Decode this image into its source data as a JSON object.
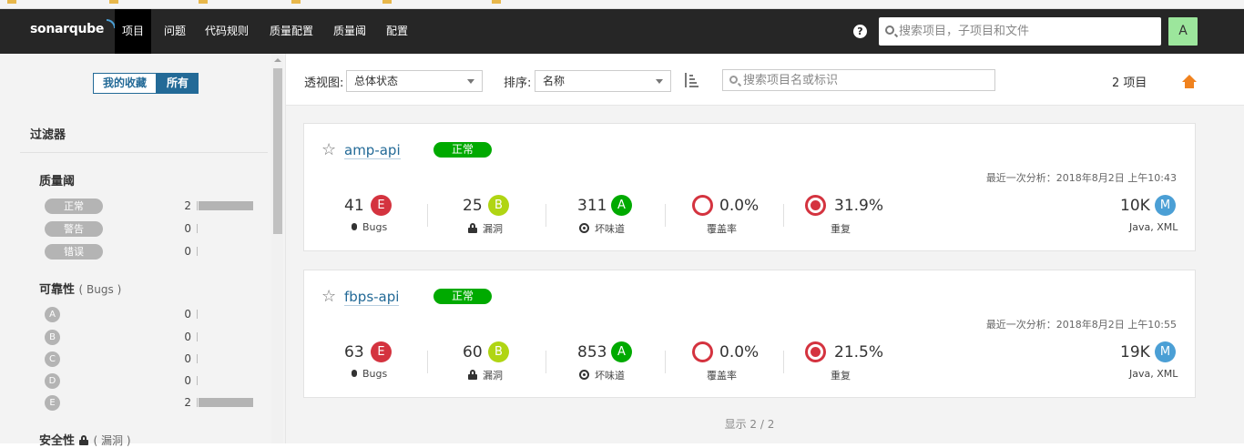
{
  "topnav": {
    "logo": "sonarqube",
    "items": [
      "项目",
      "问题",
      "代码规则",
      "质量配置",
      "质量阈",
      "配置"
    ],
    "help": "?",
    "search_placeholder": "搜索项目，子项目和文件",
    "avatar": "A"
  },
  "sidebar": {
    "toggle": {
      "favorites": "我的收藏",
      "all": "所有"
    },
    "filter_title": "过滤器",
    "quality_gate": {
      "title": "质量阈",
      "options": [
        {
          "label": "正常",
          "count": "2",
          "fraction": 1
        },
        {
          "label": "警告",
          "count": "0",
          "fraction": 0
        },
        {
          "label": "错误",
          "count": "0",
          "fraction": 0
        }
      ]
    },
    "reliability": {
      "title": "可靠性",
      "subtitle": "( Bugs )",
      "options": [
        {
          "label": "A",
          "count": "0",
          "fraction": 0
        },
        {
          "label": "B",
          "count": "0",
          "fraction": 0
        },
        {
          "label": "C",
          "count": "0",
          "fraction": 0
        },
        {
          "label": "D",
          "count": "0",
          "fraction": 0
        },
        {
          "label": "E",
          "count": "2",
          "fraction": 1
        }
      ]
    },
    "security": {
      "title": "安全性",
      "subtitle": "( 漏洞 )"
    }
  },
  "controls": {
    "perspective_label": "透视图:",
    "perspective_value": "总体状态",
    "sort_label": "排序:",
    "sort_value": "名称",
    "search_placeholder": "搜索项目名或标识",
    "project_count": "2 项目"
  },
  "projects": [
    {
      "name": "amp-api",
      "quality_gate": "正常",
      "last_analysis": "最近一次分析：2018年8月2日 上午10:43",
      "bugs": "41",
      "bugs_rating": "E",
      "bugs_label": "Bugs",
      "vulns": "25",
      "vulns_rating": "B",
      "vulns_label": "漏洞",
      "smells": "311",
      "smells_rating": "A",
      "smells_label": "坏味道",
      "coverage": "0.0%",
      "coverage_label": "覆盖率",
      "dup": "31.9%",
      "dup_label": "重复",
      "size": "10K",
      "size_rating": "M",
      "languages": "Java, XML"
    },
    {
      "name": "fbps-api",
      "quality_gate": "正常",
      "last_analysis": "最近一次分析：2018年8月2日 上午10:55",
      "bugs": "63",
      "bugs_rating": "E",
      "bugs_label": "Bugs",
      "vulns": "60",
      "vulns_rating": "B",
      "vulns_label": "漏洞",
      "smells": "853",
      "smells_rating": "A",
      "smells_label": "坏味道",
      "coverage": "0.0%",
      "coverage_label": "覆盖率",
      "dup": "21.5%",
      "dup_label": "重复",
      "size": "19K",
      "size_rating": "M",
      "languages": "Java, XML"
    }
  ],
  "footer": "显示 2 / 2",
  "colors": {
    "nav_bg": "#262626",
    "brand_blue": "#236a97",
    "rating_a": "#00aa00",
    "rating_b": "#b0d513",
    "rating_e": "#d4333f",
    "size_blue": "#4b9fd5",
    "home_orange": "#f0821e"
  },
  "icons": [
    "help-icon",
    "search-icon",
    "star-icon",
    "bug-icon",
    "lock-icon",
    "smell-icon",
    "sort-icon",
    "home-icon"
  ]
}
